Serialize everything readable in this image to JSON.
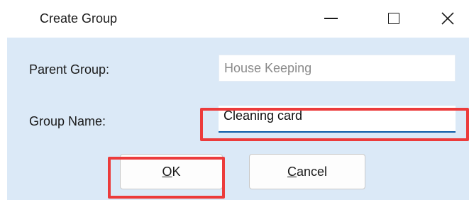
{
  "window": {
    "title": "Create Group",
    "controls": {
      "minimize_icon": "minimize-icon",
      "maximize_icon": "maximize-icon",
      "close_icon": "close-icon"
    }
  },
  "form": {
    "parent_group": {
      "label": "Parent Group:",
      "value": "House Keeping"
    },
    "group_name": {
      "label": "Group Name:",
      "value": "Cleaning card"
    }
  },
  "buttons": {
    "ok": {
      "accel": "O",
      "rest": "K"
    },
    "cancel": {
      "accel": "C",
      "rest": "ancel"
    }
  },
  "colors": {
    "dialog_background": "#dbe9f7",
    "highlight": "#ec3b3b",
    "focus_underline": "#0a5aa6"
  }
}
